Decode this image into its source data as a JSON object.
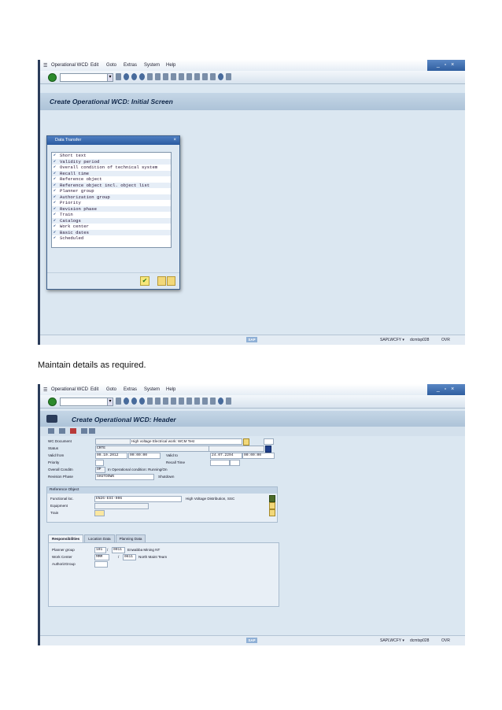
{
  "caption": "Maintain details as required.",
  "window": {
    "menu": [
      "Operational WCD",
      "Edit",
      "Goto",
      "Extras",
      "System",
      "Help"
    ],
    "controls": "_ ▫ ×"
  },
  "screen1": {
    "title": "Create Operational WCD: Initial Screen",
    "dialog": {
      "title": "Data Transfer",
      "close": "×",
      "items": [
        "Short text",
        "Validity period",
        "Overall condition of technical system",
        "Recall time",
        "Reference object",
        "Reference object incl. object list",
        "Planner group",
        "Authorization group",
        "Priority",
        "Revision phase",
        "Train",
        "Catalogs",
        "Work center",
        "Basic dates",
        "Scheduled"
      ],
      "ok": "✔"
    }
  },
  "screen2": {
    "title": "Create Operational WCD: Header",
    "fields": {
      "wcd_label": "WC Document",
      "wcd_text": "High voltage Electrical work: WCM Test",
      "status_label": "Status",
      "status_value": "CRTE",
      "valid_from_label": "Valid from",
      "valid_from_date": "09.10.2012",
      "valid_from_time": "00:00:00",
      "valid_to_label": "Valid to",
      "valid_to_date": "24.07.2294",
      "valid_to_time": "00:00:00",
      "priority_label": "Priority",
      "recall_label": "Recall Time",
      "cond_label": "Overall Conditn",
      "cond_value": "OP",
      "cond_text": "In Operational condition: Running/On",
      "revision_label": "Revision Phase",
      "revision_value": "SHUTDOWN",
      "revision_text": "Shutdown"
    },
    "ref_object": {
      "header": "Reference Object",
      "func_loc_label": "Functional loc.",
      "func_loc_value": "EN26-ESI-006",
      "func_loc_text": "High Voltage Distribution, SSC",
      "equipment_label": "Equipment",
      "train_label": "Train"
    },
    "tabs": [
      "Responsibilities",
      "Location Data",
      "Planning Data"
    ],
    "responsibilities": {
      "planner_label": "Planner group",
      "planner_value": "101",
      "planner_plant": "0011",
      "planner_text": "Enwabba Mining NT",
      "workcenter_label": "Work Center",
      "workcenter_value": "MMM",
      "workcenter_plant": "0611",
      "workcenter_text": "North Maint Team",
      "authgroup_label": "AuthorizGroup",
      "sep": "/"
    }
  },
  "status": {
    "logo": "SAP",
    "system": "SAPLWCFY ▾",
    "server": "dcmtsp028",
    "mode": "OVR"
  }
}
